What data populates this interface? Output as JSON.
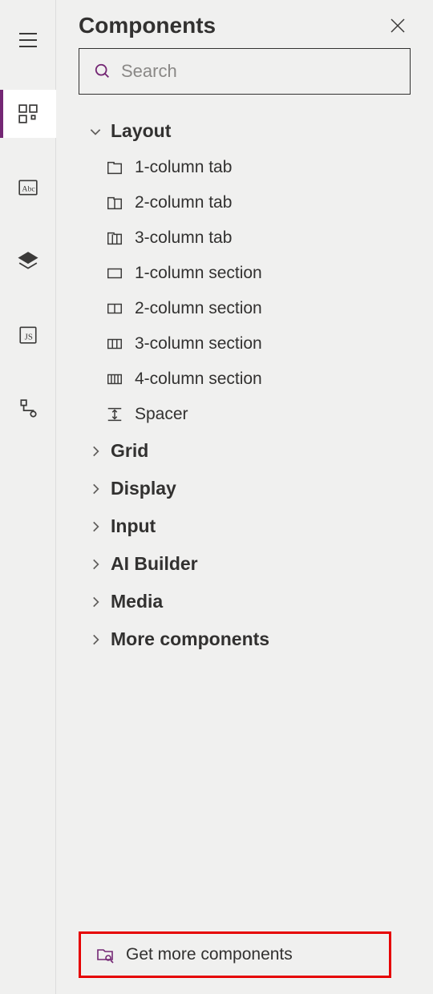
{
  "panel": {
    "title": "Components",
    "search_placeholder": "Search"
  },
  "categories": {
    "layout": {
      "label": "Layout",
      "items": [
        "1-column tab",
        "2-column tab",
        "3-column tab",
        "1-column section",
        "2-column section",
        "3-column section",
        "4-column section",
        "Spacer"
      ]
    },
    "grid": {
      "label": "Grid"
    },
    "display": {
      "label": "Display"
    },
    "input": {
      "label": "Input"
    },
    "ai_builder": {
      "label": "AI Builder"
    },
    "media": {
      "label": "Media"
    },
    "more": {
      "label": "More components"
    }
  },
  "footer": {
    "get_more_label": "Get more components"
  }
}
